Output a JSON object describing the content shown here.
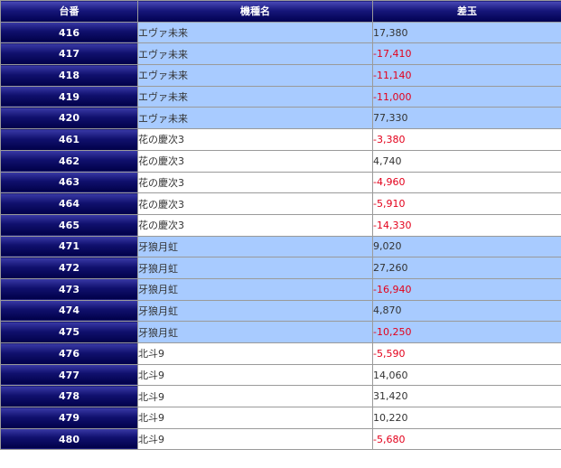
{
  "header": {
    "col_unit": "台番",
    "col_model": "機種名",
    "col_diff": "差玉"
  },
  "rows": [
    {
      "unit": "416",
      "model": "エヴァ未来",
      "diff": "17,380",
      "negative": false,
      "band": "blue"
    },
    {
      "unit": "417",
      "model": "エヴァ未来",
      "diff": "-17,410",
      "negative": true,
      "band": "blue"
    },
    {
      "unit": "418",
      "model": "エヴァ未来",
      "diff": "-11,140",
      "negative": true,
      "band": "blue"
    },
    {
      "unit": "419",
      "model": "エヴァ未来",
      "diff": "-11,000",
      "negative": true,
      "band": "blue"
    },
    {
      "unit": "420",
      "model": "エヴァ未来",
      "diff": "77,330",
      "negative": false,
      "band": "blue"
    },
    {
      "unit": "461",
      "model": "花の慶次3",
      "diff": "-3,380",
      "negative": true,
      "band": "white"
    },
    {
      "unit": "462",
      "model": "花の慶次3",
      "diff": "4,740",
      "negative": false,
      "band": "white"
    },
    {
      "unit": "463",
      "model": "花の慶次3",
      "diff": "-4,960",
      "negative": true,
      "band": "white"
    },
    {
      "unit": "464",
      "model": "花の慶次3",
      "diff": "-5,910",
      "negative": true,
      "band": "white"
    },
    {
      "unit": "465",
      "model": "花の慶次3",
      "diff": "-14,330",
      "negative": true,
      "band": "white"
    },
    {
      "unit": "471",
      "model": "牙狼月虹",
      "diff": "9,020",
      "negative": false,
      "band": "blue"
    },
    {
      "unit": "472",
      "model": "牙狼月虹",
      "diff": "27,260",
      "negative": false,
      "band": "blue"
    },
    {
      "unit": "473",
      "model": "牙狼月虹",
      "diff": "-16,940",
      "negative": true,
      "band": "blue"
    },
    {
      "unit": "474",
      "model": "牙狼月虹",
      "diff": "4,870",
      "negative": false,
      "band": "blue"
    },
    {
      "unit": "475",
      "model": "牙狼月虹",
      "diff": "-10,250",
      "negative": true,
      "band": "blue"
    },
    {
      "unit": "476",
      "model": "北斗9",
      "diff": "-5,590",
      "negative": true,
      "band": "white"
    },
    {
      "unit": "477",
      "model": "北斗9",
      "diff": "14,060",
      "negative": false,
      "band": "white"
    },
    {
      "unit": "478",
      "model": "北斗9",
      "diff": "31,420",
      "negative": false,
      "band": "white"
    },
    {
      "unit": "479",
      "model": "北斗9",
      "diff": "10,220",
      "negative": false,
      "band": "white"
    },
    {
      "unit": "480",
      "model": "北斗9",
      "diff": "-5,680",
      "negative": true,
      "band": "white"
    }
  ]
}
